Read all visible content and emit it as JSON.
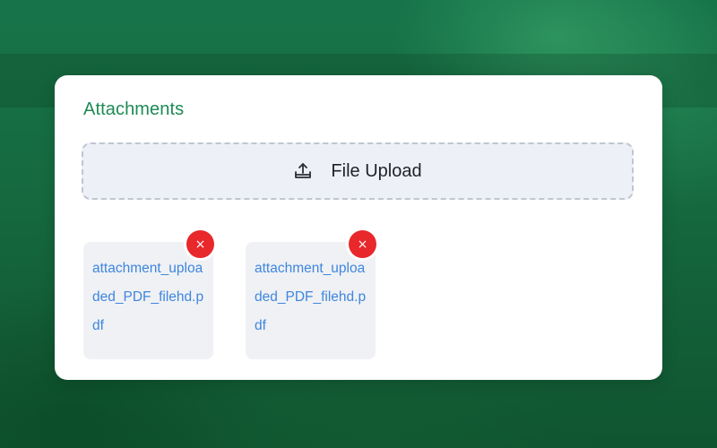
{
  "attachments": {
    "title": "Attachments",
    "upload": {
      "label": "File Upload",
      "icon": "upload-icon"
    },
    "files": [
      {
        "name": "attachment_uploaded_PDF_filehd.pdf",
        "remove_icon": "close-icon",
        "remove_glyph": "×"
      },
      {
        "name": "attachment_uploaded_PDF_filehd.pdf",
        "remove_icon": "close-icon",
        "remove_glyph": "×"
      }
    ]
  },
  "colors": {
    "accent_green": "#1d8a55",
    "link_blue": "#3f86df",
    "danger_red": "#e8282b",
    "dropzone_bg": "#edf1f7",
    "tile_bg": "#eff1f4"
  }
}
